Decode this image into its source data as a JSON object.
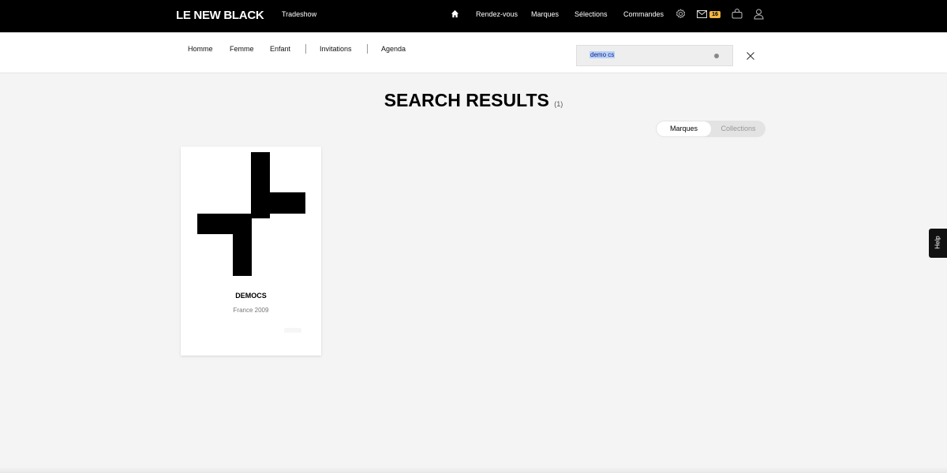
{
  "header": {
    "logo": "LE NEW BLACK",
    "tradeshow": "Tradeshow",
    "nav": [
      "Rendez-vous",
      "Marques",
      "Sélections",
      "Commandes"
    ],
    "mail_badge": "16"
  },
  "subnav": {
    "items": [
      "Homme",
      "Femme",
      "Enfant",
      "Invitations",
      "Agenda"
    ]
  },
  "search": {
    "value": "demo cs"
  },
  "results": {
    "title": "SEARCH RESULTS",
    "count": "(1)",
    "toggle": [
      "Marques",
      "Collections"
    ],
    "active_toggle": "Marques"
  },
  "cards": [
    {
      "name": "DEMOCS",
      "origin": "France 2009"
    }
  ],
  "help": "Help",
  "colors": {
    "topbar": "#000000",
    "badge": "#f2b544",
    "background": "#f4f4f4"
  }
}
